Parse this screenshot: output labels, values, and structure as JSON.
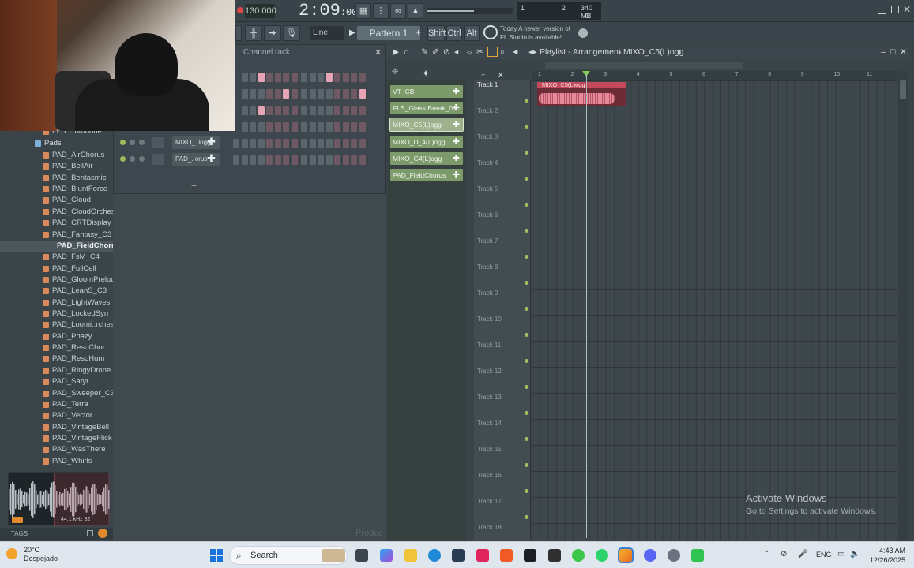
{
  "transport": {
    "tempo": "130.000",
    "time_main": "2:09",
    "time_sub": ":00",
    "memory": "340 MB",
    "mem_num_top": "1",
    "mem_num_mid": "2",
    "mem_num_low": "0"
  },
  "toolbar": {
    "line_mode": "Line",
    "pattern": "Pattern 1",
    "shift": "Shift",
    "ctrl": "Ctrl",
    "alt": "Alt",
    "news_line1": "Today  A newer version of",
    "news_line2": "FL Studio is available!"
  },
  "browser": {
    "partial_item": "FLS Trombone",
    "folder": "Pads",
    "items": [
      "PAD_AirChorus",
      "PAD_BellAir",
      "PAD_Bentasmic",
      "PAD_BluntForce",
      "PAD_Cloud",
      "PAD_CloudOrchestra",
      "PAD_CRTDisplay",
      "PAD_Fantasy_C3",
      "PAD_FieldChorus",
      "PAD_FsM_C4",
      "PAD_FullCell",
      "PAD_GloomPrelude",
      "PAD_LeanS_C3",
      "PAD_LightWaves",
      "PAD_LockedSyn",
      "PAD_Loomi..rchestra",
      "PAD_Phazy",
      "PAD_ResoChor",
      "PAD_ResoHum",
      "PAD_RingyDrone",
      "PAD_Satyr",
      "PAD_Sweeper_C3",
      "PAD_Terra",
      "PAD_Vector",
      "PAD_VintageBell",
      "PAD_VintageFlick",
      "PAD_WasThere",
      "PAD_Whirls"
    ],
    "selected": "PAD_FieldChorus",
    "tags_label": "TAGS",
    "wave_info": "44.1 kHz 32"
  },
  "channel_rack": {
    "title": "Channel rack",
    "channels": [
      "MIXO_..logg",
      "PAD_..orus"
    ],
    "add": "+"
  },
  "playlist": {
    "title": "Playlist - Arrangement",
    "crumb": "MIXO_C5(L)ogg",
    "picker": [
      "VT_CB",
      "FLS_Glass Break_01",
      "MIXO_C5(L)ogg",
      "MIXO_D_4(L)ogg",
      "MIXO_G4(L)ogg",
      "PAD_FieldChorus"
    ],
    "picker_selected": "MIXO_C5(L)ogg",
    "tracks": [
      "Track 1",
      "Track 2",
      "Track 3",
      "Track 4",
      "Track 5",
      "Track 6",
      "Track 7",
      "Track 8",
      "Track 9",
      "Track 10",
      "Track 11",
      "Track 12",
      "Track 13",
      "Track 14",
      "Track 15",
      "Track 16",
      "Track 17",
      "Track 18"
    ],
    "ruler": [
      "1",
      "2",
      "3",
      "4",
      "5",
      "6",
      "7",
      "8",
      "9",
      "10",
      "11"
    ],
    "clip_label": "MIXO_C5(L)ogg"
  },
  "watermark": {
    "title": "Activate Windows",
    "sub": "Go to Settings to activate Windows."
  },
  "faded_label": "Produc",
  "taskbar": {
    "temp": "20°C",
    "weather": "Despejado",
    "search": "Search",
    "lang": "ENG",
    "time": "4:43 AM",
    "date": "12/26/2025"
  }
}
